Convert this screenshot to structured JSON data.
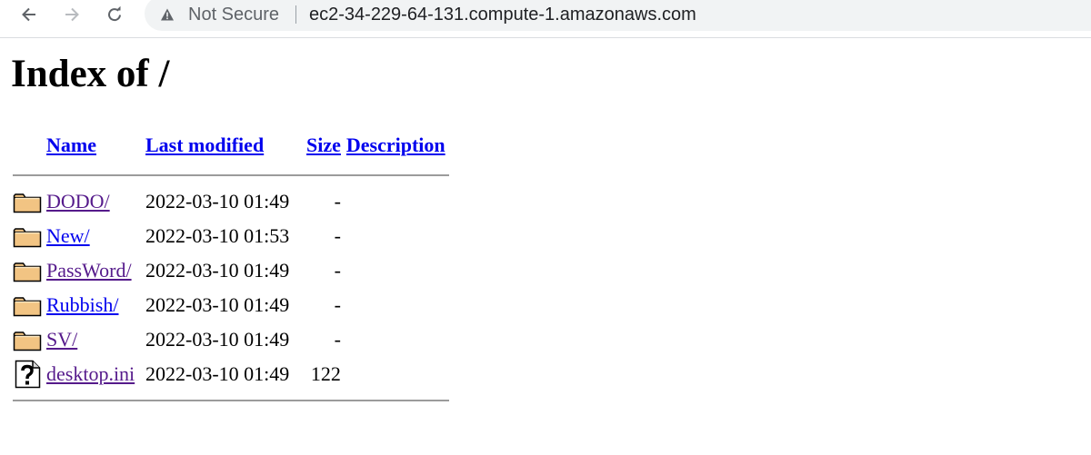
{
  "browser": {
    "security_label": "Not Secure",
    "url": "ec2-34-229-64-131.compute-1.amazonaws.com"
  },
  "page": {
    "title": "Index of /",
    "columns": {
      "name": "Name",
      "last_modified": "Last modified",
      "size": "Size",
      "description": "Description"
    },
    "entries": [
      {
        "icon": "folder-icon",
        "name": "DODO/",
        "modified": "2022-03-10 01:49",
        "size": "-"
      },
      {
        "icon": "folder-icon",
        "name": "New/",
        "modified": "2022-03-10 01:53",
        "size": "-"
      },
      {
        "icon": "folder-icon",
        "name": "PassWord/",
        "modified": "2022-03-10 01:49",
        "size": "-"
      },
      {
        "icon": "folder-icon",
        "name": "Rubbish/",
        "modified": "2022-03-10 01:49",
        "size": "-"
      },
      {
        "icon": "folder-icon",
        "name": "SV/",
        "modified": "2022-03-10 01:49",
        "size": "-"
      },
      {
        "icon": "unknown-file-icon",
        "name": "desktop.ini",
        "modified": "2022-03-10 01:49",
        "size": "122"
      }
    ]
  },
  "colors": {
    "link": "#0000ee",
    "visited_link": "#551a8b",
    "omnibox_bg": "#f1f3f4"
  }
}
